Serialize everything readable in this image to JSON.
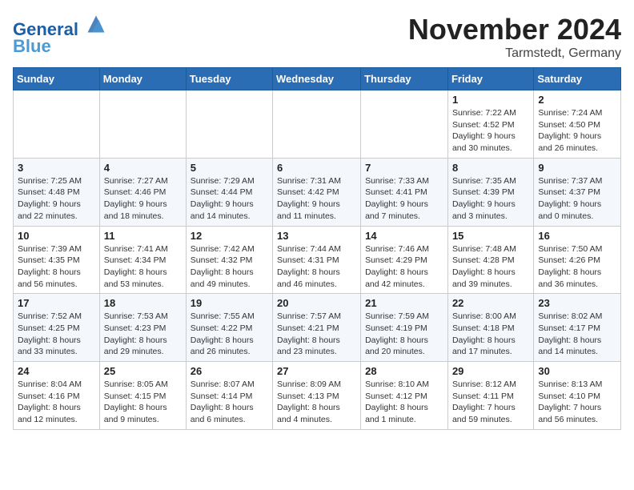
{
  "header": {
    "logo_line1": "General",
    "logo_line2": "Blue",
    "month_title": "November 2024",
    "location": "Tarmstedt, Germany"
  },
  "days_of_week": [
    "Sunday",
    "Monday",
    "Tuesday",
    "Wednesday",
    "Thursday",
    "Friday",
    "Saturday"
  ],
  "weeks": [
    [
      {
        "day": "",
        "info": ""
      },
      {
        "day": "",
        "info": ""
      },
      {
        "day": "",
        "info": ""
      },
      {
        "day": "",
        "info": ""
      },
      {
        "day": "",
        "info": ""
      },
      {
        "day": "1",
        "info": "Sunrise: 7:22 AM\nSunset: 4:52 PM\nDaylight: 9 hours and 30 minutes."
      },
      {
        "day": "2",
        "info": "Sunrise: 7:24 AM\nSunset: 4:50 PM\nDaylight: 9 hours and 26 minutes."
      }
    ],
    [
      {
        "day": "3",
        "info": "Sunrise: 7:25 AM\nSunset: 4:48 PM\nDaylight: 9 hours and 22 minutes."
      },
      {
        "day": "4",
        "info": "Sunrise: 7:27 AM\nSunset: 4:46 PM\nDaylight: 9 hours and 18 minutes."
      },
      {
        "day": "5",
        "info": "Sunrise: 7:29 AM\nSunset: 4:44 PM\nDaylight: 9 hours and 14 minutes."
      },
      {
        "day": "6",
        "info": "Sunrise: 7:31 AM\nSunset: 4:42 PM\nDaylight: 9 hours and 11 minutes."
      },
      {
        "day": "7",
        "info": "Sunrise: 7:33 AM\nSunset: 4:41 PM\nDaylight: 9 hours and 7 minutes."
      },
      {
        "day": "8",
        "info": "Sunrise: 7:35 AM\nSunset: 4:39 PM\nDaylight: 9 hours and 3 minutes."
      },
      {
        "day": "9",
        "info": "Sunrise: 7:37 AM\nSunset: 4:37 PM\nDaylight: 9 hours and 0 minutes."
      }
    ],
    [
      {
        "day": "10",
        "info": "Sunrise: 7:39 AM\nSunset: 4:35 PM\nDaylight: 8 hours and 56 minutes."
      },
      {
        "day": "11",
        "info": "Sunrise: 7:41 AM\nSunset: 4:34 PM\nDaylight: 8 hours and 53 minutes."
      },
      {
        "day": "12",
        "info": "Sunrise: 7:42 AM\nSunset: 4:32 PM\nDaylight: 8 hours and 49 minutes."
      },
      {
        "day": "13",
        "info": "Sunrise: 7:44 AM\nSunset: 4:31 PM\nDaylight: 8 hours and 46 minutes."
      },
      {
        "day": "14",
        "info": "Sunrise: 7:46 AM\nSunset: 4:29 PM\nDaylight: 8 hours and 42 minutes."
      },
      {
        "day": "15",
        "info": "Sunrise: 7:48 AM\nSunset: 4:28 PM\nDaylight: 8 hours and 39 minutes."
      },
      {
        "day": "16",
        "info": "Sunrise: 7:50 AM\nSunset: 4:26 PM\nDaylight: 8 hours and 36 minutes."
      }
    ],
    [
      {
        "day": "17",
        "info": "Sunrise: 7:52 AM\nSunset: 4:25 PM\nDaylight: 8 hours and 33 minutes."
      },
      {
        "day": "18",
        "info": "Sunrise: 7:53 AM\nSunset: 4:23 PM\nDaylight: 8 hours and 29 minutes."
      },
      {
        "day": "19",
        "info": "Sunrise: 7:55 AM\nSunset: 4:22 PM\nDaylight: 8 hours and 26 minutes."
      },
      {
        "day": "20",
        "info": "Sunrise: 7:57 AM\nSunset: 4:21 PM\nDaylight: 8 hours and 23 minutes."
      },
      {
        "day": "21",
        "info": "Sunrise: 7:59 AM\nSunset: 4:19 PM\nDaylight: 8 hours and 20 minutes."
      },
      {
        "day": "22",
        "info": "Sunrise: 8:00 AM\nSunset: 4:18 PM\nDaylight: 8 hours and 17 minutes."
      },
      {
        "day": "23",
        "info": "Sunrise: 8:02 AM\nSunset: 4:17 PM\nDaylight: 8 hours and 14 minutes."
      }
    ],
    [
      {
        "day": "24",
        "info": "Sunrise: 8:04 AM\nSunset: 4:16 PM\nDaylight: 8 hours and 12 minutes."
      },
      {
        "day": "25",
        "info": "Sunrise: 8:05 AM\nSunset: 4:15 PM\nDaylight: 8 hours and 9 minutes."
      },
      {
        "day": "26",
        "info": "Sunrise: 8:07 AM\nSunset: 4:14 PM\nDaylight: 8 hours and 6 minutes."
      },
      {
        "day": "27",
        "info": "Sunrise: 8:09 AM\nSunset: 4:13 PM\nDaylight: 8 hours and 4 minutes."
      },
      {
        "day": "28",
        "info": "Sunrise: 8:10 AM\nSunset: 4:12 PM\nDaylight: 8 hours and 1 minute."
      },
      {
        "day": "29",
        "info": "Sunrise: 8:12 AM\nSunset: 4:11 PM\nDaylight: 7 hours and 59 minutes."
      },
      {
        "day": "30",
        "info": "Sunrise: 8:13 AM\nSunset: 4:10 PM\nDaylight: 7 hours and 56 minutes."
      }
    ]
  ]
}
